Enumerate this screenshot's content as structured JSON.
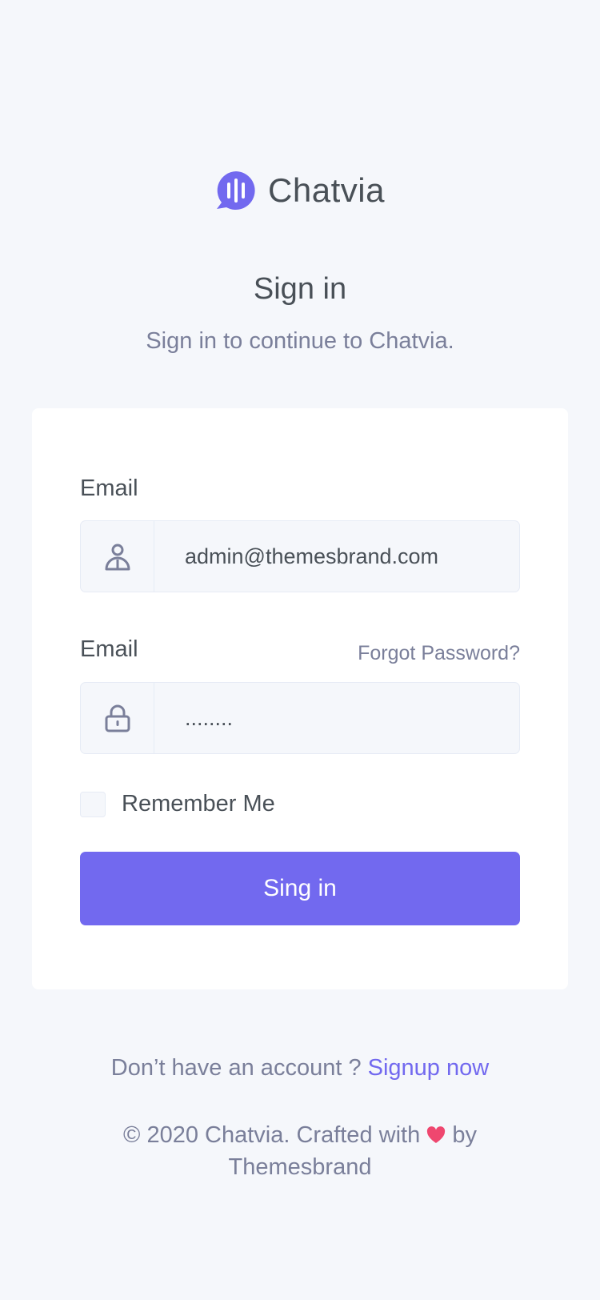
{
  "brand": {
    "name": "Chatvia",
    "logo_icon": "chat-bubble-soundwave-icon"
  },
  "header": {
    "title": "Sign in",
    "subtitle": "Sign in to continue to Chatvia."
  },
  "form": {
    "email_label": "Email",
    "email_value": "admin@themesbrand.com",
    "email_icon": "user-icon",
    "password_label": "Email",
    "password_value": "........",
    "password_icon": "lock-icon",
    "forgot_label": "Forgot Password?",
    "remember_label": "Remember Me",
    "remember_checked": false,
    "submit_label": "Sing in"
  },
  "footer": {
    "signup_prompt": "Don’t have an account ?",
    "signup_link": "Signup now",
    "copyright_prefix": "© 2020 Chatvia. Crafted with",
    "heart_icon": "heart-icon",
    "copyright_suffix": "by Themesbrand"
  },
  "colors": {
    "primary": "#7269ef",
    "background": "#f5f7fb",
    "text": "#495057",
    "muted": "#7a7f9a",
    "heart": "#ef476f"
  }
}
